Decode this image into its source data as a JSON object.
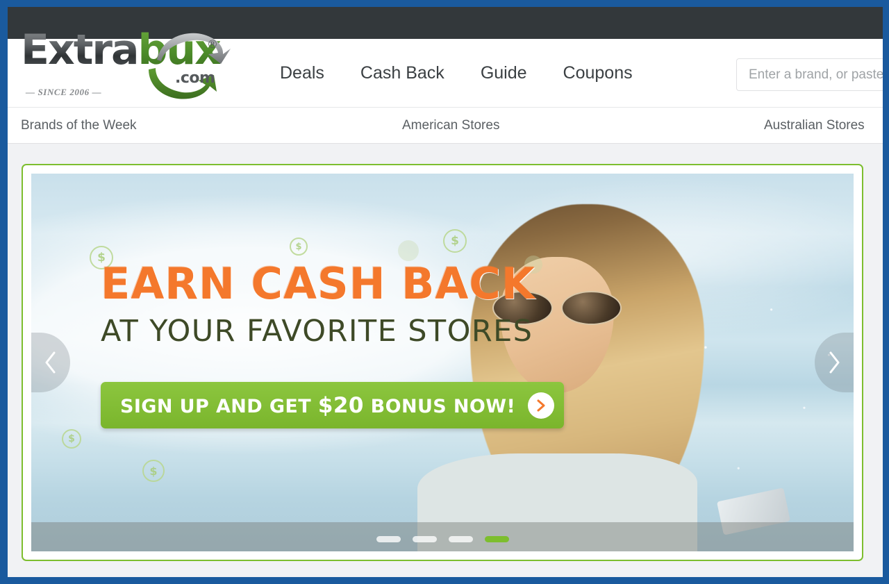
{
  "brand": {
    "name_part1": "Extra",
    "name_part2": "bux",
    "domain_suffix": ".com",
    "registered_mark": "®",
    "tagline": "—  SINCE 2006  —",
    "color_green": "#4a8a2c",
    "color_dark": "#454a4d"
  },
  "header": {
    "nav": [
      {
        "label": "Deals"
      },
      {
        "label": "Cash Back"
      },
      {
        "label": "Guide"
      },
      {
        "label": "Coupons"
      }
    ],
    "search": {
      "value": "",
      "placeholder": "Enter a brand, or paste a product link"
    }
  },
  "secondary_nav": {
    "items": [
      {
        "label": "Brands of the Week"
      },
      {
        "label": "American Stores"
      },
      {
        "label": "Australian Stores"
      }
    ]
  },
  "banner": {
    "headline_line1": "EARN CASH BACK",
    "headline_line2": "AT YOUR FAVORITE STORES",
    "cta_prefix": "SIGN UP AND GET ",
    "cta_amount": "$20",
    "cta_suffix": " BONUS NOW!",
    "cta_arrow_glyph": "›",
    "prev_arrow_glyph": "‹",
    "next_arrow_glyph": "›",
    "coin_symbol": "$",
    "border_color": "#7dbe2e",
    "headline_color": "#f4782c",
    "subhead_color": "#3e4a27",
    "cta_color": "#8cc63f",
    "dots": [
      {
        "active": false
      },
      {
        "active": false
      },
      {
        "active": false
      },
      {
        "active": true
      }
    ]
  },
  "page": {
    "frame_color": "#1a5a9e",
    "background_color": "#f1f2f4",
    "topbar_color": "#33383b"
  }
}
